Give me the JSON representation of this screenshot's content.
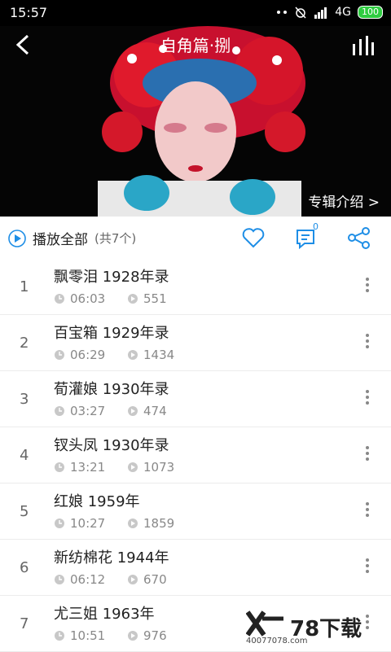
{
  "status": {
    "time": "15:57",
    "network": "4G",
    "battery": "100"
  },
  "header": {
    "title": "自角篇·捌",
    "album_intro": "专辑介绍 >"
  },
  "actions": {
    "play_all": "播放全部",
    "count": "(共7个)",
    "comment_count": "0"
  },
  "tracks": [
    {
      "num": "1",
      "title": "飘零泪 1928年录",
      "duration": "06:03",
      "plays": "551"
    },
    {
      "num": "2",
      "title": "百宝箱 1929年录",
      "duration": "06:29",
      "plays": "1434"
    },
    {
      "num": "3",
      "title": "荀灌娘 1930年录",
      "duration": "03:27",
      "plays": "474"
    },
    {
      "num": "4",
      "title": "钗头凤 1930年录",
      "duration": "13:21",
      "plays": "1073"
    },
    {
      "num": "5",
      "title": "红娘 1959年",
      "duration": "10:27",
      "plays": "1859"
    },
    {
      "num": "6",
      "title": "新纺棉花 1944年",
      "duration": "06:12",
      "plays": "670"
    },
    {
      "num": "7",
      "title": "尤三姐 1963年",
      "duration": "10:51",
      "plays": "976"
    }
  ],
  "watermark": {
    "text": "78下载",
    "sub": "40077078.com"
  },
  "colors": {
    "accent": "#1e8ee6",
    "hero_red": "#d4182a"
  }
}
